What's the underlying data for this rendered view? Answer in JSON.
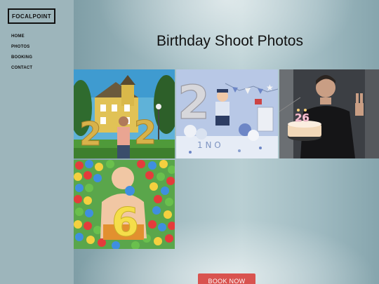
{
  "brand": {
    "logo_text": "FOCALPOINT"
  },
  "nav": {
    "items": [
      {
        "label": "HOME"
      },
      {
        "label": "PHOTOS"
      },
      {
        "label": "BOOKING"
      },
      {
        "label": "CONTACT"
      }
    ]
  },
  "main": {
    "title": "Birthday Shoot Photos",
    "cta_label": "BOOK NOW",
    "cta_color": "#d9534f"
  },
  "gallery": {
    "photos": [
      {
        "name": "photo-22-balloons-man",
        "cake_number": "22"
      },
      {
        "name": "photo-2-balloon-toddler",
        "cake_number": "2"
      },
      {
        "name": "photo-26-cake-man",
        "cake_number": "26"
      },
      {
        "name": "photo-6-ball-pit-baby",
        "cake_number": "6"
      }
    ]
  }
}
